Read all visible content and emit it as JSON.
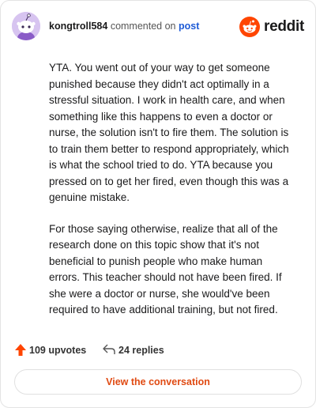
{
  "header": {
    "username": "kongtroll584",
    "action_text": "commented on",
    "post_link": "post",
    "brand_name": "reddit",
    "brand_color": "#FF4500",
    "avatar_color": "#D7C4F0"
  },
  "comment": {
    "paragraphs": [
      "YTA. You went out of your way to get someone punished because they didn't act optimally in a stressful situation. I work in health care, and when something like this happens to even a doctor or nurse, the solution isn't to fire them. The solution is to train them better to respond appropriately, which is what the school tried to do. YTA because you pressed on to get her fired, even though this was a genuine mistake.",
      "For those saying otherwise, realize that all of the research done on this topic show that it's not beneficial to punish people who make human errors. This teacher should not have been fired. If she were a doctor or nurse, she would've been required to have additional training, but not fired."
    ]
  },
  "actions": {
    "upvotes": "109 upvotes",
    "replies": "24 replies"
  },
  "footer": {
    "view_label": "View the conversation"
  },
  "icons": {
    "avatar": "snoo-avatar-icon",
    "brand": "reddit-logo-icon",
    "upvote": "upvote-arrow-icon",
    "reply": "reply-arrow-icon"
  }
}
